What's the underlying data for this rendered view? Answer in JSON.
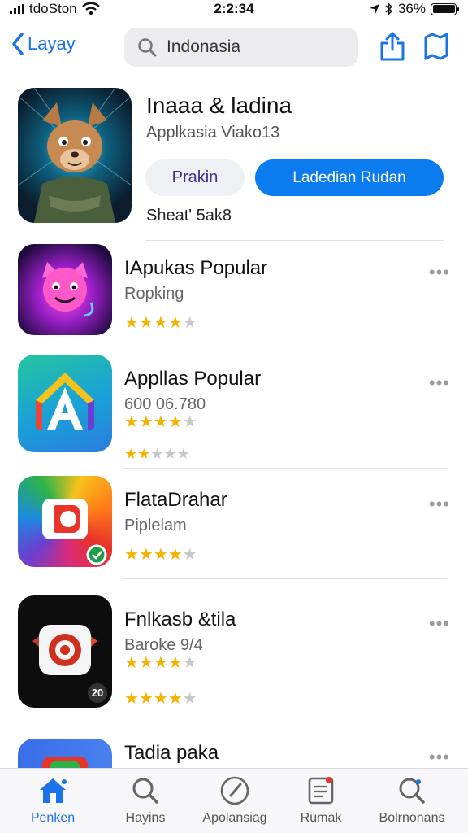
{
  "status": {
    "carrier": "tdoSton",
    "time": "2:2:34",
    "battery": "36%"
  },
  "nav": {
    "back_label": "Layay",
    "search_value": "Indonasia"
  },
  "featured": {
    "title": "Inaaa & ladina",
    "subtitle": "Applkasia Viako13",
    "secondary_button": "Prakin",
    "primary_button": "Ladedian Rudan",
    "meta": "Sheat' 5ak8"
  },
  "apps": [
    {
      "title": "IApukas Popular",
      "subtitle": "Ropking",
      "rating": 4,
      "second_rating": null
    },
    {
      "title": "Appllas Popular",
      "subtitle": "600 06.780",
      "rating": 4,
      "second_rating": 2
    },
    {
      "title": "FlataDrahar",
      "subtitle": "Piplelam",
      "rating": 4,
      "second_rating": null
    },
    {
      "title": "Fnlkasb &tila",
      "subtitle": "Baroke 9/4",
      "rating": 4,
      "second_rating": 4.5,
      "badge": "20"
    },
    {
      "title": "Tadia paka",
      "subtitle": "",
      "rating": null,
      "second_rating": null
    }
  ],
  "more_label": "•••",
  "tabs": [
    {
      "label": "Penken",
      "icon": "home-icon"
    },
    {
      "label": "Hayins",
      "icon": "search-icon"
    },
    {
      "label": "Apolansiag",
      "icon": "compass-icon"
    },
    {
      "label": "Rumak",
      "icon": "document-icon"
    },
    {
      "label": "Bolrnonans",
      "icon": "profile-search-icon"
    }
  ],
  "colors": {
    "accent": "#0a7cf0",
    "star": "#f5b301"
  }
}
